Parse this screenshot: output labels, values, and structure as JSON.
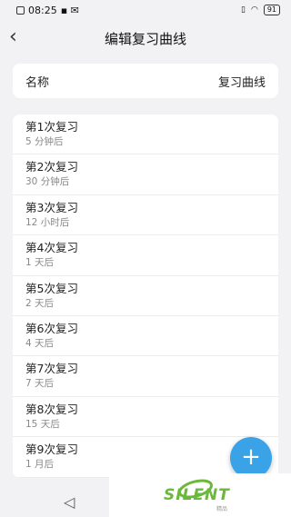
{
  "status": {
    "time": "08:25",
    "battery": "91"
  },
  "header": {
    "title": "编辑复习曲线"
  },
  "name_row": {
    "label": "名称",
    "value": "复习曲线"
  },
  "reviews": [
    {
      "title": "第1次复习",
      "interval": "5 分钟后"
    },
    {
      "title": "第2次复习",
      "interval": "30 分钟后"
    },
    {
      "title": "第3次复习",
      "interval": "12 小时后"
    },
    {
      "title": "第4次复习",
      "interval": "1 天后"
    },
    {
      "title": "第5次复习",
      "interval": "2 天后"
    },
    {
      "title": "第6次复习",
      "interval": "4 天后"
    },
    {
      "title": "第7次复习",
      "interval": "7 天后"
    },
    {
      "title": "第8次复习",
      "interval": "15 天后"
    },
    {
      "title": "第9次复习",
      "interval": "1 月后"
    }
  ],
  "fab": {
    "icon": "plus-icon",
    "label": "+"
  },
  "watermark": {
    "text": "SILENT",
    "sub": "精品"
  },
  "colors": {
    "accent": "#3aa3e8",
    "background": "#f2f2f4",
    "watermark": "#6bb83a"
  }
}
